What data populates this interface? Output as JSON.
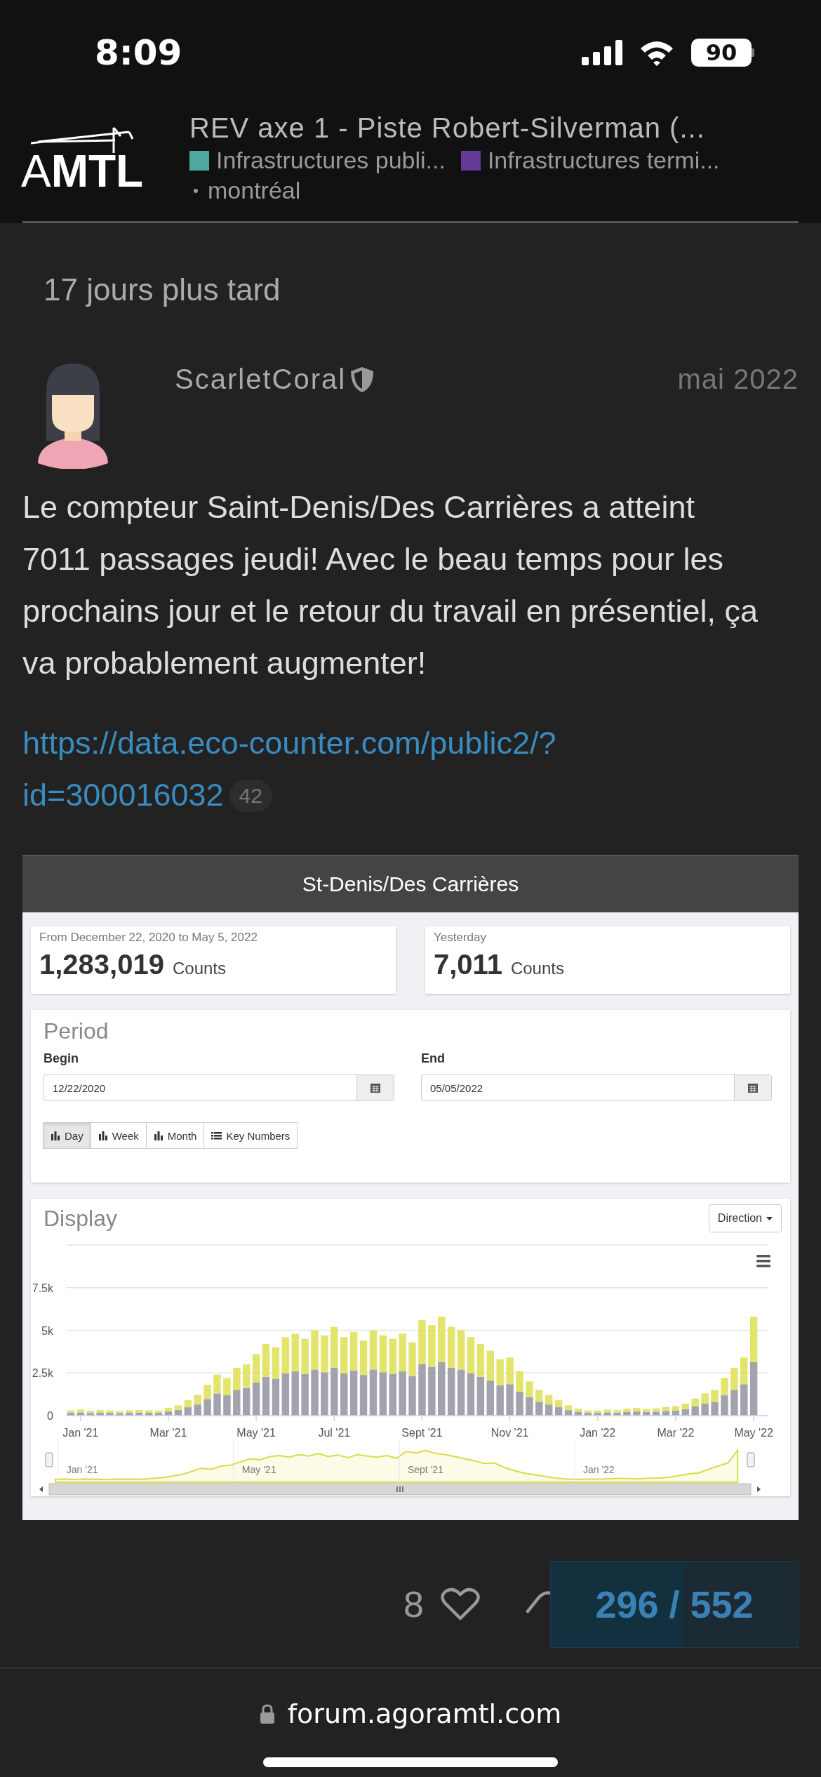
{
  "status_bar": {
    "time": "8:09",
    "battery": "90"
  },
  "header": {
    "logo": "A**MTL**",
    "title": "REV axe 1 - Piste Robert-Silverman (...",
    "categories": [
      {
        "label": "Infrastructures publi...",
        "color": "#4fa89e"
      },
      {
        "label": "Infrastructures termi...",
        "color": "#653a96"
      }
    ],
    "tags": [
      "montréal"
    ]
  },
  "time_gap": "17 jours plus tard",
  "post": {
    "author": "ScarletCoral",
    "date": "mai 2022",
    "body": "Le compteur Saint-Denis/Des Carrières a atteint 7011 passages jeudi! Avec le beau temps pour les prochains jour et le retour du travail en présentiel, ça va probablement augmenter!",
    "link": "https://data.eco-counter.com/public2/?id=300016032",
    "click_count": "42",
    "embed": {
      "title": "St-Denis/Des Carrières",
      "stats": [
        {
          "caption": "From December 22, 2020 to May 5, 2022",
          "value": "1,283,019",
          "unit": "Counts"
        },
        {
          "caption": "Yesterday",
          "value": "7,011",
          "unit": "Counts"
        }
      ],
      "period": {
        "title": "Period",
        "begin_label": "Begin",
        "begin_value": "12/22/2020",
        "end_label": "End",
        "end_value": "05/05/2022",
        "buttons": [
          {
            "label": "Day",
            "kind": "chart",
            "selected": true
          },
          {
            "label": "Week",
            "kind": "chart",
            "selected": false
          },
          {
            "label": "Month",
            "kind": "chart",
            "selected": false
          },
          {
            "label": "Key Numbers",
            "kind": "list",
            "selected": false
          }
        ]
      },
      "display": {
        "title": "Display",
        "dropdown": "Direction",
        "chart_data": {
          "type": "bar",
          "stacked": true,
          "grid": true,
          "ylim": [
            0,
            10000
          ],
          "categories": [
            null,
            "Jan '21",
            null,
            null,
            null,
            null,
            null,
            null,
            null,
            null,
            "Mar '21",
            null,
            null,
            null,
            null,
            null,
            null,
            null,
            null,
            "May '21",
            null,
            null,
            null,
            null,
            null,
            null,
            null,
            "Jul '21",
            null,
            null,
            null,
            null,
            null,
            null,
            null,
            null,
            "Sept '21",
            null,
            null,
            null,
            null,
            null,
            null,
            null,
            null,
            "Nov '21",
            null,
            null,
            null,
            null,
            null,
            null,
            null,
            null,
            "Jan '22",
            null,
            null,
            null,
            null,
            null,
            null,
            null,
            "Mar '22",
            null,
            null,
            null,
            null,
            null,
            null,
            null,
            "May '22"
          ],
          "yticks": [
            {
              "value": 0,
              "label": "0"
            },
            {
              "value": 2500,
              "label": "2.5k"
            },
            {
              "value": 5000,
              "label": "5k"
            },
            {
              "value": 7500,
              "label": "7.5k"
            }
          ],
          "series": [
            {
              "color": "#a3a3ad",
              "values": [
                160,
                190,
                150,
                170,
                160,
                140,
                170,
                180,
                160,
                160,
                240,
                330,
                490,
                650,
                970,
                1300,
                1190,
                1510,
                1620,
                1940,
                2270,
                2160,
                2480,
                2590,
                2430,
                2700,
                2540,
                2810,
                2480,
                2650,
                2380,
                2700,
                2540,
                2430,
                2590,
                2320,
                3020,
                2860,
                3130,
                2810,
                2700,
                2480,
                2270,
                2050,
                1780,
                1840,
                1400,
                1080,
                810,
                650,
                490,
                320,
                220,
                160,
                160,
                190,
                170,
                220,
                240,
                210,
                230,
                270,
                300,
                380,
                540,
                700,
                810,
                1190,
                1510,
                1840,
                3130
              ]
            },
            {
              "color": "#e3e46c",
              "values": [
                140,
                160,
                130,
                150,
                140,
                120,
                140,
                150,
                140,
                130,
                210,
                270,
                410,
                550,
                830,
                1100,
                1010,
                1290,
                1380,
                1660,
                1930,
                1840,
                2120,
                2210,
                2070,
                2300,
                2160,
                2390,
                2120,
                2250,
                2020,
                2300,
                2160,
                2070,
                2210,
                1980,
                2580,
                2440,
                2670,
                2390,
                2300,
                2120,
                1930,
                1750,
                1520,
                1560,
                1200,
                920,
                690,
                550,
                410,
                280,
                180,
                140,
                140,
                160,
                150,
                180,
                210,
                170,
                190,
                230,
                250,
                320,
                460,
                600,
                690,
                1010,
                1290,
                1560,
                2670
              ]
            }
          ]
        },
        "navigator_labels": [
          "Jan '21",
          "May '21",
          "Sept '21",
          "Jan '22"
        ]
      }
    }
  },
  "actions": {
    "likes": "8"
  },
  "progress": {
    "text": "296 / 552",
    "level": 0.536
  },
  "browser": {
    "url": "forum.agoramtl.com"
  }
}
